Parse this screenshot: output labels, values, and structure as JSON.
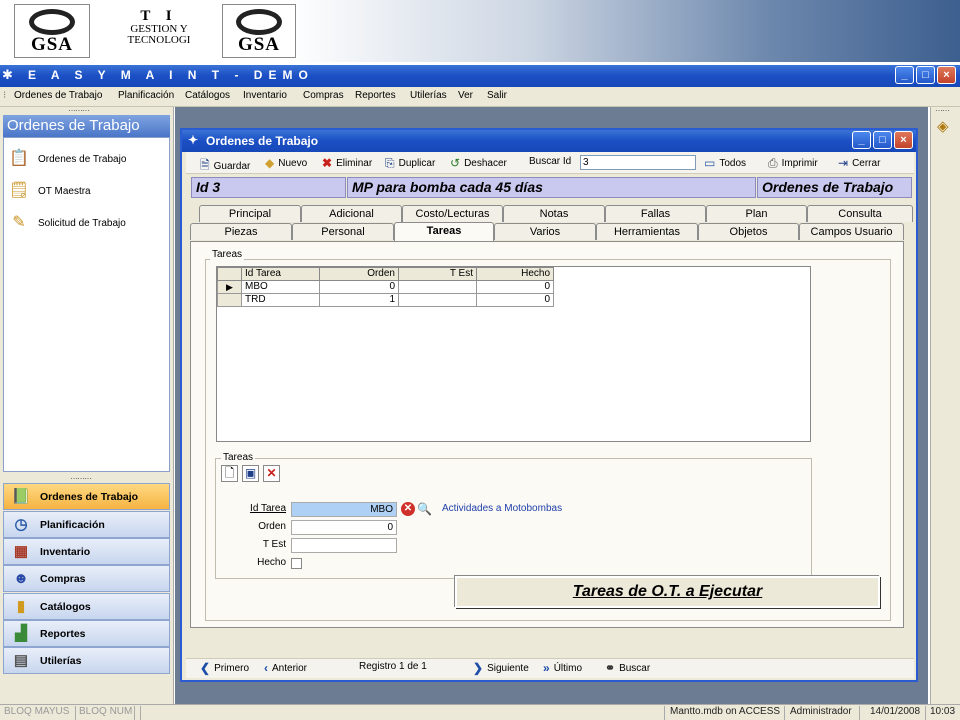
{
  "logos": {
    "left": "GSA",
    "right": "GSA",
    "brand_line1": "T I",
    "brand_line2": "GESTION Y",
    "brand_line3": "TECNOLOGI"
  },
  "window": {
    "title": "E A S Y   M A I N T - DEMO",
    "min": "_",
    "max": "□",
    "close": "×"
  },
  "menu": [
    "Ordenes de Trabajo",
    "Planificación",
    "Catálogos",
    "Inventario",
    "Compras",
    "Reportes",
    "Utilerías",
    "Ver",
    "Salir"
  ],
  "left_panel": {
    "title": "Ordenes de Trabajo",
    "items": [
      {
        "label": "Ordenes de Trabajo",
        "icon": "clipboard-icon"
      },
      {
        "label": "OT Maestra",
        "icon": "notepad-icon"
      },
      {
        "label": "Solicitud de Trabajo",
        "icon": "pencil-icon"
      }
    ],
    "nav": [
      {
        "label": "Ordenes de Trabajo",
        "icon": "book-icon",
        "active": true
      },
      {
        "label": "Planificación",
        "icon": "clock-icon"
      },
      {
        "label": "Inventario",
        "icon": "shelf-icon"
      },
      {
        "label": "Compras",
        "icon": "person-icon"
      },
      {
        "label": "Catálogos",
        "icon": "folder-icon"
      },
      {
        "label": "Reportes",
        "icon": "chart-icon"
      },
      {
        "label": "Utilerías",
        "icon": "tools-icon"
      }
    ]
  },
  "child": {
    "title": "Ordenes de Trabajo",
    "toolbar": {
      "guardar": "Guardar",
      "nuevo": "Nuevo",
      "eliminar": "Eliminar",
      "duplicar": "Duplicar",
      "deshacer": "Deshacer",
      "buscar_id": "Buscar Id",
      "search_value": "3",
      "todos": "Todos",
      "imprimir": "Imprimir",
      "cerrar": "Cerrar"
    },
    "header": {
      "id": "Id  3",
      "description": "MP para bomba cada 45 días",
      "module": "Ordenes de Trabajo"
    },
    "tabs_row1": [
      "Principal",
      "Adicional",
      "Costo/Lecturas",
      "Notas",
      "Fallas",
      "Plan",
      "Consulta"
    ],
    "tabs_row2": [
      "Piezas",
      "Personal",
      "Tareas",
      "Varios",
      "Herramientas",
      "Objetos",
      "Campos Usuario"
    ],
    "selected_tab": "Tareas",
    "grid": {
      "legend": "Tareas",
      "columns": [
        "Id Tarea",
        "Orden",
        "T Est",
        "Hecho"
      ],
      "rows": [
        {
          "id": "MBO",
          "orden": "0",
          "test": "",
          "hecho": "0",
          "current": true
        },
        {
          "id": "TRD",
          "orden": "1",
          "test": "",
          "hecho": "0"
        }
      ],
      "row_pointer": "▶"
    },
    "detail": {
      "legend": "Tareas",
      "labels": {
        "id": "Id Tarea",
        "orden": "Orden",
        "test": "T Est",
        "hecho": "Hecho"
      },
      "values": {
        "id": "MBO",
        "orden": "0",
        "test": ""
      },
      "description": "Actividades a Motobombas"
    },
    "banner": "Tareas de O.T. a Ejecutar",
    "nav": {
      "primero": "Primero",
      "anterior": "Anterior",
      "registro": "Registro 1 de 1",
      "siguiente": "Siguiente",
      "ultimo": "Último",
      "buscar": "Buscar"
    }
  },
  "status": {
    "caps": "BLOQ MAYUS",
    "num": "BLOQ NUM",
    "db": "Mantto.mdb on ACCESS",
    "user": "Administrador",
    "date": "14/01/2008",
    "time": "10:03"
  },
  "colors": {
    "title_blue": "#1b4fc4",
    "header_lavender": "#c9c9f0",
    "active_nav": "#f5b342",
    "highlight_input": "#aed0f4"
  }
}
